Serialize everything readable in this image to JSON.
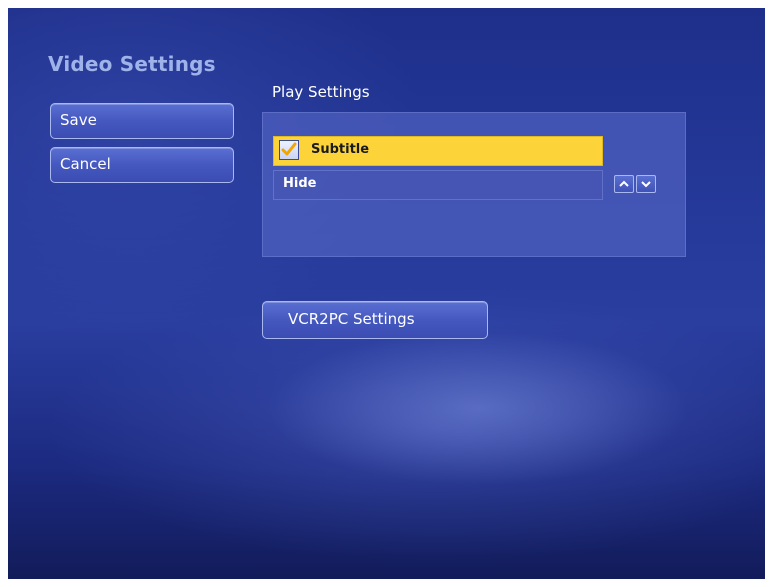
{
  "header": {
    "title": "Video Settings"
  },
  "actions": {
    "save_label": "Save",
    "cancel_label": "Cancel"
  },
  "play_settings": {
    "section_label": "Play Settings",
    "option": {
      "label": "Subtitle",
      "checked": true,
      "value": "Hide"
    },
    "stepper": {
      "up_icon": "chevron-up-icon",
      "down_icon": "chevron-down-icon"
    }
  },
  "vcr2pc": {
    "label": "VCR2PC Settings"
  },
  "colors": {
    "background": "#2a3ea0",
    "highlight": "#fcd43a",
    "title": "#9fb3ea",
    "button": "#4558bf"
  }
}
